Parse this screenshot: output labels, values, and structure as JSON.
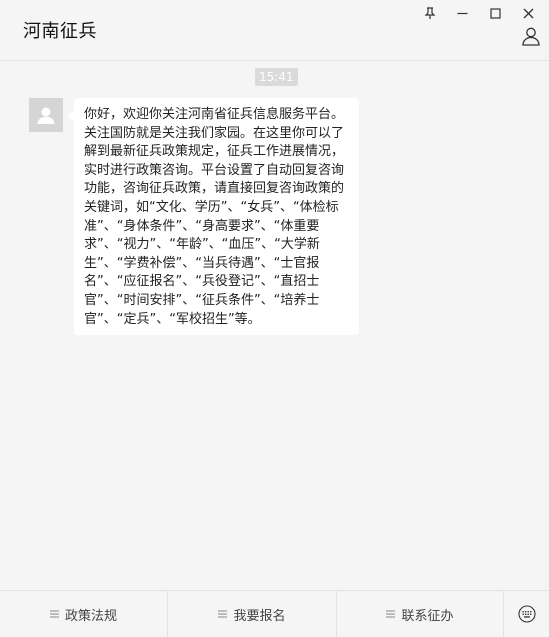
{
  "header": {
    "title": "河南征兵"
  },
  "window_controls": [
    "pin-icon",
    "minimize-icon",
    "maximize-icon",
    "close-icon"
  ],
  "chat": {
    "timestamp": "15:41",
    "messages": [
      {
        "sender": "official-account",
        "text": "你好，欢迎你关注河南省征兵信息服务平台。关注国防就是关注我们家园。在这里你可以了解到最新征兵政策规定，征兵工作进展情况，实时进行政策咨询。平台设置了自动回复咨询功能，咨询征兵政策，请直接回复咨询政策的关键词，如“文化、学历”、“女兵”、“体检标准”、“身体条件”、“身高要求”、“体重要求”、“视力”、“年龄”、“血压”、“大学新生”、“学费补偿”、“当兵待遇”、“士官报名”、“应征报名”、“兵役登记”、“直招士官”、“时间安排”、“征兵条件”、“培养士官”、“定兵”、“军校招生”等。"
      }
    ]
  },
  "bottom_menu": {
    "items": [
      {
        "label": "政策法规"
      },
      {
        "label": "我要报名"
      },
      {
        "label": "联系征办"
      }
    ]
  },
  "colors": {
    "background": "#f5f5f5",
    "bubble": "#ffffff",
    "timestamp_bg": "#dadada",
    "divider": "#e2e2e2"
  }
}
